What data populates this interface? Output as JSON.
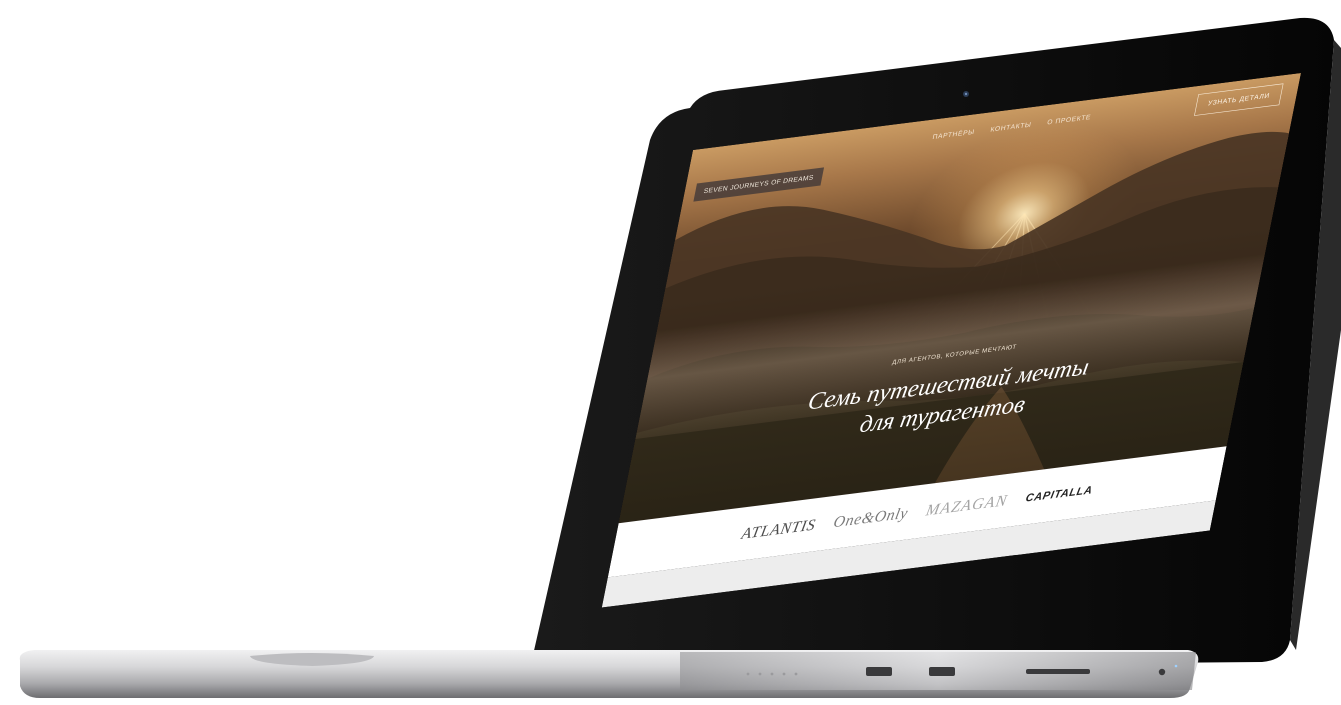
{
  "site": {
    "brand_tag": "Seven Journeys of Dreams",
    "nav": [
      "Партнёры",
      "Контакты",
      "О проекте"
    ],
    "cta": "Узнать детали",
    "eyebrow": "Для агентов, которые мечтают",
    "headline_line1": "Семь путешествий мечты",
    "headline_line2": "для турагентов"
  },
  "brands": [
    "ATLANTIS",
    "One&Only",
    "MAZAGAN",
    "CAPITALLA"
  ],
  "colors": {
    "bezel": "#0b0b0b",
    "hero_warm": "#c99a62",
    "hero_dark": "#2a2014",
    "brand_strip": "#ffffff",
    "gray_band": "#ededed",
    "aluminum": "#cfcfd1"
  },
  "icons": [
    "camera-icon",
    "usb-port-icon",
    "sd-slot-icon",
    "headphone-jack-icon",
    "power-led-icon"
  ]
}
